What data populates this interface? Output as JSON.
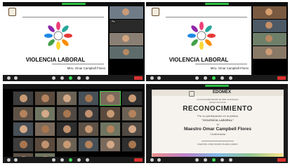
{
  "top_left": {
    "slide_title": "VIOLENCIA LABORAL",
    "presenter": "Mtro. Omar Campbell Flores",
    "participant_names": [
      "Pin"
    ]
  },
  "top_right": {
    "slide_title": "VIOLENCIA LABORAL",
    "presenter": "Mtro. Omar Campbell Flores"
  },
  "gallery": {
    "tile_names": [
      "",
      "",
      "",
      "",
      "",
      "",
      "",
      "",
      "",
      "",
      "",
      "",
      "",
      "",
      "",
      "",
      "",
      "",
      "",
      "",
      "",
      "",
      "",
      "",
      "",
      ""
    ]
  },
  "certificate": {
    "header_line": "La Universidad Estatal del Valle de Ecatepec",
    "header_line2": "otorga el presente",
    "logo_text": "EDOMÉX",
    "title": "RECONOCIMIENTO",
    "reason": "Por su participación en la plática",
    "topic": "\"VIOLENCIA LABORAL\"",
    "to": "al",
    "recipient": "Maestro Omar Campbell Flores",
    "role": "Conferencista",
    "signature_line": "MAESTRO JOSÉ ÁLVARO VALDÉS LÁZARO"
  },
  "colors": {
    "zoom_green": "#2dbb44",
    "end_red": "#d9312f",
    "rosette": [
      "#e53935",
      "#fb8c00",
      "#fdd835",
      "#43a047",
      "#1e88e5",
      "#8e24aa",
      "#ec407a",
      "#26a69a"
    ]
  }
}
